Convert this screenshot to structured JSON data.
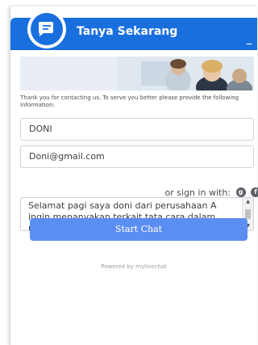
{
  "header": {
    "title": "Tanya Sekarang",
    "minimize_label": "–",
    "color": "#1a6fde"
  },
  "intro_text": "Thank you for contacting us. To serve you better please provide the following information:",
  "form": {
    "name_value": "DONI",
    "email_value": "Doni@gmail.com",
    "signin_label": "or sign in with:",
    "social_icons": [
      "google-plus-icon",
      "facebook-icon"
    ],
    "message_value": "Selamat pagi saya doni dari perusahaan A ingin menanyakan terkait tata cara dalam pendaftaran LPSE"
  },
  "start_button_label": "Start Chat",
  "start_button_color": "#5b8ef2",
  "footer_text": "Powered by mylivechat"
}
